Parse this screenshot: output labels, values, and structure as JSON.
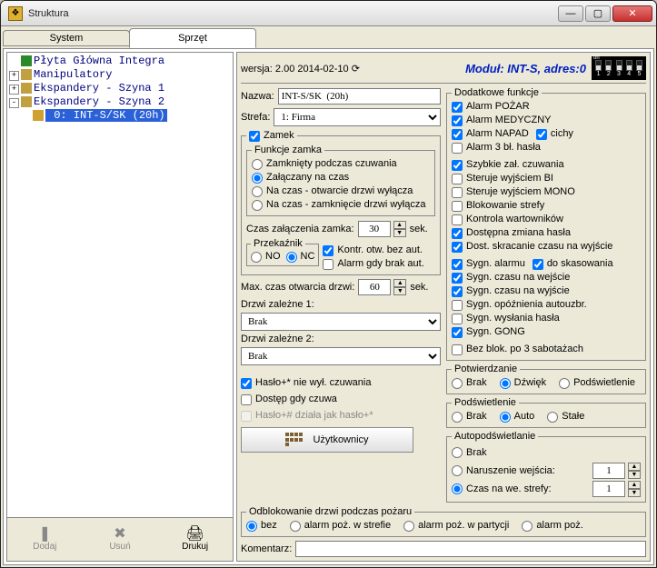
{
  "window": {
    "title": "Struktura"
  },
  "tabs": {
    "system": "System",
    "sprzet": "Sprzęt"
  },
  "tree": {
    "root1": "Płyta Główna Integra",
    "root2": "Manipulatory",
    "root3": "Ekspandery - Szyna 1",
    "root4": "Ekspandery - Szyna 2",
    "child": " 0:  INT-S/SK   (20h)"
  },
  "treetools": {
    "dodaj": "Dodaj",
    "usun": "Usuń",
    "drukuj": "Drukuj"
  },
  "header": {
    "wersja_label": "wersja:",
    "wersja_value": "2.00 2014-02-10",
    "modul": "Moduł: INT-S, adres:0"
  },
  "fields": {
    "nazwa_label": "Nazwa:",
    "nazwa_value": "INT-S/SK  (20h)",
    "strefa_label": "Strefa:",
    "strefa_value": "1: Firma"
  },
  "zamek": {
    "legend": "Zamek",
    "checked": "Zamek",
    "funkcje_legend": "Funkcje zamka",
    "r1": "Zamknięty podczas czuwania",
    "r2": "Załączany na czas",
    "r3": "Na czas - otwarcie drzwi wyłącza",
    "r4": "Na czas - zamknięcie drzwi wyłącza",
    "czas_label": "Czas załączenia zamka:",
    "czas_value": "30",
    "czas_unit": "sek.",
    "przek_legend": "Przekaźnik",
    "no": "NO",
    "nc": "NC",
    "kontr": "Kontr. otw. bez aut.",
    "alarm": "Alarm gdy brak aut."
  },
  "drzwi": {
    "max_label": "Max. czas otwarcia drzwi:",
    "max_value": "60",
    "max_unit": "sek.",
    "dz1_label": "Drzwi zależne 1:",
    "dz2_label": "Drzwi zależne 2:",
    "brak": "Brak"
  },
  "haslo": {
    "h1": "Hasło+* nie wył. czuwania",
    "h2": "Dostęp gdy czuwa",
    "h3": "Hasło+# działa jak hasło+*"
  },
  "uzytkownicy": "Użytkownicy",
  "funkcje": {
    "legend": "Dodatkowe funkcje",
    "pozar": "Alarm POŻAR",
    "medyczny": "Alarm MEDYCZNY",
    "napad": "Alarm NAPAD",
    "cichy": "cichy",
    "alarm3bl": "Alarm 3 bł. hasła",
    "szybkie": "Szybkie zał. czuwania",
    "bi": "Steruje wyjściem BI",
    "mono": "Steruje wyjściem MONO",
    "blokstr": "Blokowanie strefy",
    "kontrwart": "Kontrola wartowników",
    "dozm": "Dostępna zmiana hasła",
    "doskr": "Dost. skracanie czasu na wyjście",
    "sygalarm": "Sygn. alarmu",
    "dokas": "do skasowania",
    "sygwe": "Sygn. czasu na wejście",
    "sygwy": "Sygn. czasu na wyjście",
    "sygopz": "Sygn. opóźnienia autouzbr.",
    "sygwys": "Sygn. wysłania hasła",
    "gong": "Sygn. GONG",
    "bezblok": "Bez blok. po 3 sabotażach"
  },
  "potw": {
    "legend": "Potwierdzanie",
    "brak": "Brak",
    "dzwiek": "Dźwięk",
    "pods": "Podświetlenie"
  },
  "podsw": {
    "legend": "Podświetlenie",
    "brak": "Brak",
    "auto": "Auto",
    "stale": "Stałe"
  },
  "autopodsw": {
    "legend": "Autopodświetlanie",
    "brak": "Brak",
    "narusz": "Naruszenie wejścia:",
    "czas": "Czas na we. strefy:",
    "v1": "1",
    "v2": "1"
  },
  "odblok": {
    "legend": "Odblokowanie drzwi podczas pożaru",
    "bez": "bez",
    "str": "alarm poż. w strefie",
    "part": "alarm poż. w partycji",
    "poz": "alarm poż."
  },
  "komentarz": {
    "label": "Komentarz:",
    "value": ""
  }
}
